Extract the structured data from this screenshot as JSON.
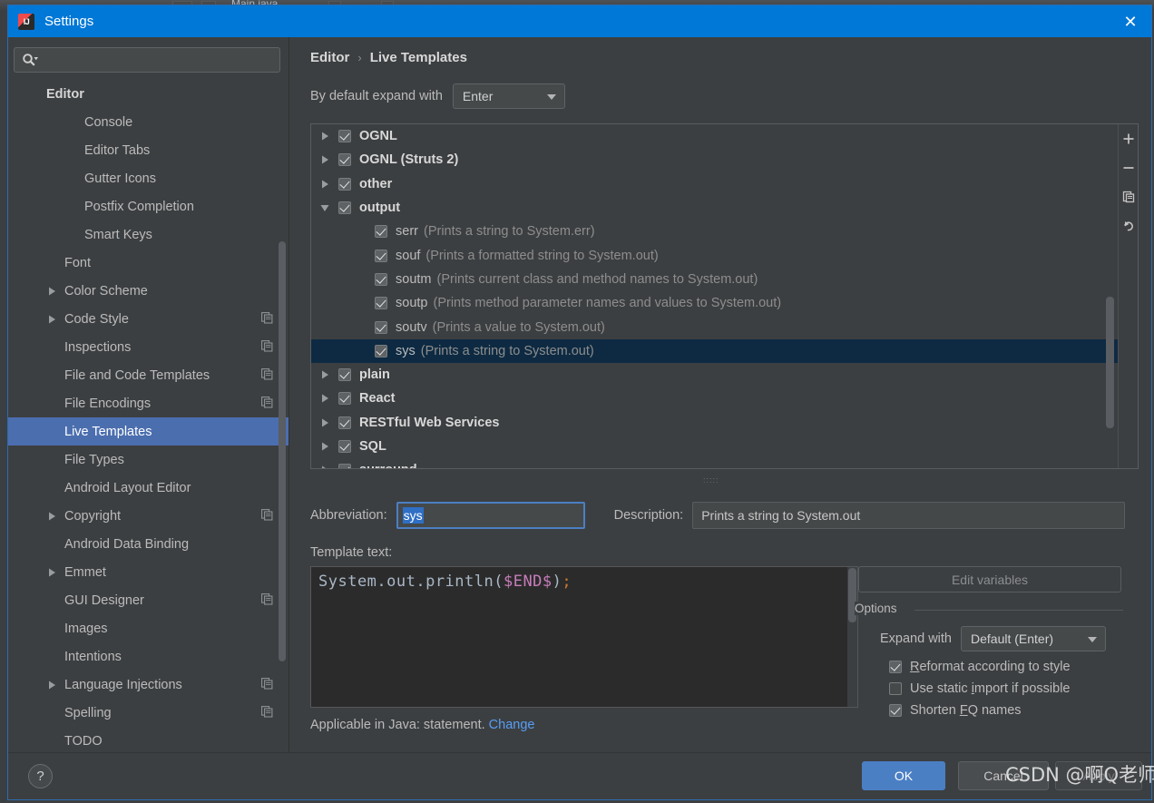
{
  "backdrop": {
    "tab_label": "Main.java"
  },
  "window": {
    "title": "Settings",
    "logo_icon": "intellij-idea-logo",
    "close_icon": "close-icon"
  },
  "sidebar": {
    "search": {
      "placeholder": "",
      "value": "",
      "icon": "search-icon",
      "dropdown_icon": "chevron-down-icon"
    },
    "items": [
      {
        "label": "Editor",
        "indent": 0,
        "arrow": false,
        "bold": true,
        "copy": false,
        "selected": false
      },
      {
        "label": "Console",
        "indent": 2,
        "arrow": false,
        "bold": false,
        "copy": false,
        "selected": false
      },
      {
        "label": "Editor Tabs",
        "indent": 2,
        "arrow": false,
        "bold": false,
        "copy": false,
        "selected": false
      },
      {
        "label": "Gutter Icons",
        "indent": 2,
        "arrow": false,
        "bold": false,
        "copy": false,
        "selected": false
      },
      {
        "label": "Postfix Completion",
        "indent": 2,
        "arrow": false,
        "bold": false,
        "copy": false,
        "selected": false
      },
      {
        "label": "Smart Keys",
        "indent": 2,
        "arrow": false,
        "bold": false,
        "copy": false,
        "selected": false
      },
      {
        "label": "Font",
        "indent": 1,
        "arrow": false,
        "bold": false,
        "copy": false,
        "selected": false
      },
      {
        "label": "Color Scheme",
        "indent": 1,
        "arrow": true,
        "bold": false,
        "copy": false,
        "selected": false
      },
      {
        "label": "Code Style",
        "indent": 1,
        "arrow": true,
        "bold": false,
        "copy": true,
        "selected": false
      },
      {
        "label": "Inspections",
        "indent": 1,
        "arrow": false,
        "bold": false,
        "copy": true,
        "selected": false
      },
      {
        "label": "File and Code Templates",
        "indent": 1,
        "arrow": false,
        "bold": false,
        "copy": true,
        "selected": false
      },
      {
        "label": "File Encodings",
        "indent": 1,
        "arrow": false,
        "bold": false,
        "copy": true,
        "selected": false
      },
      {
        "label": "Live Templates",
        "indent": 1,
        "arrow": false,
        "bold": false,
        "copy": false,
        "selected": true
      },
      {
        "label": "File Types",
        "indent": 1,
        "arrow": false,
        "bold": false,
        "copy": false,
        "selected": false
      },
      {
        "label": "Android Layout Editor",
        "indent": 1,
        "arrow": false,
        "bold": false,
        "copy": false,
        "selected": false
      },
      {
        "label": "Copyright",
        "indent": 1,
        "arrow": true,
        "bold": false,
        "copy": true,
        "selected": false
      },
      {
        "label": "Android Data Binding",
        "indent": 1,
        "arrow": false,
        "bold": false,
        "copy": false,
        "selected": false
      },
      {
        "label": "Emmet",
        "indent": 1,
        "arrow": true,
        "bold": false,
        "copy": false,
        "selected": false
      },
      {
        "label": "GUI Designer",
        "indent": 1,
        "arrow": false,
        "bold": false,
        "copy": true,
        "selected": false
      },
      {
        "label": "Images",
        "indent": 1,
        "arrow": false,
        "bold": false,
        "copy": false,
        "selected": false
      },
      {
        "label": "Intentions",
        "indent": 1,
        "arrow": false,
        "bold": false,
        "copy": false,
        "selected": false
      },
      {
        "label": "Language Injections",
        "indent": 1,
        "arrow": true,
        "bold": false,
        "copy": true,
        "selected": false
      },
      {
        "label": "Spelling",
        "indent": 1,
        "arrow": false,
        "bold": false,
        "copy": true,
        "selected": false
      },
      {
        "label": "TODO",
        "indent": 1,
        "arrow": false,
        "bold": false,
        "copy": false,
        "selected": false
      }
    ]
  },
  "panel": {
    "breadcrumb": {
      "parent": "Editor",
      "separator": "›",
      "current": "Live Templates"
    },
    "expand_with": {
      "label": "By default expand with",
      "value": "Enter"
    },
    "toolbar": {
      "add_icon": "plus-icon",
      "remove_icon": "minus-icon",
      "duplicate_icon": "copy-icon",
      "revert_icon": "undo-icon"
    },
    "templates": [
      {
        "type": "group",
        "label": "OGNL",
        "expanded": false,
        "checked": true
      },
      {
        "type": "group",
        "label": "OGNL (Struts 2)",
        "expanded": false,
        "checked": true
      },
      {
        "type": "group",
        "label": "other",
        "expanded": false,
        "checked": true
      },
      {
        "type": "group",
        "label": "output",
        "expanded": true,
        "checked": true
      },
      {
        "type": "child",
        "label": "serr",
        "desc": "(Prints a string to System.err)",
        "checked": true,
        "selected": false
      },
      {
        "type": "child",
        "label": "souf",
        "desc": "(Prints a formatted string to System.out)",
        "checked": true,
        "selected": false
      },
      {
        "type": "child",
        "label": "soutm",
        "desc": "(Prints current class and method names to System.out)",
        "checked": true,
        "selected": false
      },
      {
        "type": "child",
        "label": "soutp",
        "desc": "(Prints method parameter names and values to System.out)",
        "checked": true,
        "selected": false
      },
      {
        "type": "child",
        "label": "soutv",
        "desc": "(Prints a value to System.out)",
        "checked": true,
        "selected": false
      },
      {
        "type": "child",
        "label": "sys",
        "desc": "(Prints a string to System.out)",
        "checked": true,
        "selected": true
      },
      {
        "type": "group",
        "label": "plain",
        "expanded": false,
        "checked": true
      },
      {
        "type": "group",
        "label": "React",
        "expanded": false,
        "checked": true
      },
      {
        "type": "group",
        "label": "RESTful Web Services",
        "expanded": false,
        "checked": true
      },
      {
        "type": "group",
        "label": "SQL",
        "expanded": false,
        "checked": true
      },
      {
        "type": "group",
        "label": "surround",
        "expanded": false,
        "checked": true
      }
    ],
    "editor": {
      "abbreviation_label": "Abbreviation:",
      "abbreviation_value": "sys",
      "description_label": "Description:",
      "description_value": "Prints a string to System.out",
      "template_text_label": "Template text:",
      "template_text_prefix": "System.out.println(",
      "template_text_variable": "$END$",
      "template_text_close": ")",
      "template_text_semicolon": ";",
      "edit_variables_label": "Edit variables"
    },
    "options": {
      "legend": "Options",
      "expand_with_label": "Expand with",
      "expand_with_value": "Default (Enter)",
      "checkboxes": [
        {
          "label_pre": "",
          "accel": "R",
          "label_post": "eformat according to style",
          "checked": true
        },
        {
          "label_pre": "Use static ",
          "accel": "i",
          "label_post": "mport if possible",
          "checked": false
        },
        {
          "label_pre": "Shorten ",
          "accel": "F",
          "label_post": "Q names",
          "checked": true
        }
      ]
    },
    "applicable": {
      "text": "Applicable in Java: statement.",
      "link": "Change"
    }
  },
  "footer": {
    "help_label": "?",
    "ok_label": "OK",
    "cancel_label": "Cancel",
    "apply_label": "Apply"
  },
  "watermark": {
    "text": "CSDN @啊Q老师"
  }
}
